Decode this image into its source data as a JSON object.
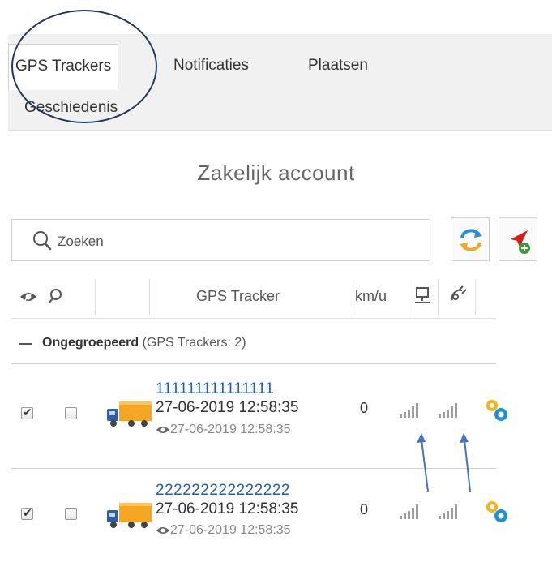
{
  "tabs": [
    {
      "label": "GPS Trackers",
      "active": true
    },
    {
      "label": "Notificaties",
      "active": false
    },
    {
      "label": "Plaatsen",
      "active": false
    },
    {
      "label": "Geschiedenis",
      "active": false
    }
  ],
  "heading": "Zakelijk account",
  "search": {
    "placeholder": "Zoeken",
    "value": ""
  },
  "toolbar": {
    "refresh_icon": "refresh-icon",
    "add_tracker_icon": "add-location-icon"
  },
  "table": {
    "columns": {
      "visibility_icon": "eye-icon",
      "search_icon": "search-icon",
      "tracker": "GPS Tracker",
      "speed": "km/u",
      "network_icon": "network-icon",
      "satellite_icon": "satellite-icon"
    },
    "group": {
      "name": "Ongegroepeerd",
      "count_text": "(GPS Trackers: 2)"
    },
    "rows": [
      {
        "visible": true,
        "selected": false,
        "name": "111111111111111",
        "timestamp": "27-06-2019 12:58:35",
        "seen": "27-06-2019 12:58:35",
        "speed": "0",
        "gsm_signal_level": 0,
        "gps_signal_level": 0
      },
      {
        "visible": true,
        "selected": false,
        "name": "222222222222222",
        "timestamp": "27-06-2019 12:58:35",
        "seen": "27-06-2019 12:58:35",
        "speed": "0",
        "gsm_signal_level": 0,
        "gps_signal_level": 0
      }
    ]
  },
  "colors": {
    "accent_blue": "#1f5fae",
    "annotation": "#1f3864",
    "truck_orange": "#f5a623",
    "gear_blue": "#1e90d6",
    "gear_yellow": "#f3b51c"
  }
}
